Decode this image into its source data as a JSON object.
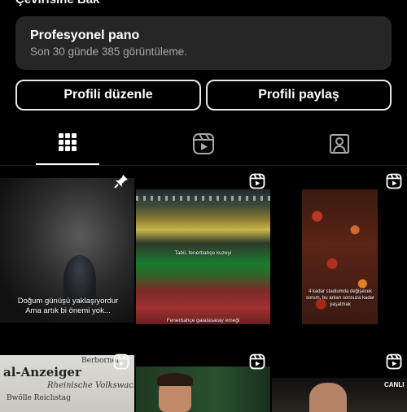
{
  "profile": {
    "top_partial_text": "Çevirisine Bak"
  },
  "dashboard": {
    "title": "Profesyonel pano",
    "subtitle": "Son 30 günde 385 görüntüleme."
  },
  "actions": {
    "edit_label": "Profili düzenle",
    "share_label": "Profili paylaş"
  },
  "tabs": [
    {
      "name": "grid",
      "icon": "grid-icon",
      "active": true
    },
    {
      "name": "reels",
      "icon": "reels-icon",
      "active": false
    },
    {
      "name": "tagged",
      "icon": "tagged-person-icon",
      "active": false
    }
  ],
  "posts": [
    {
      "badge": "pin-icon",
      "caption_line1": "Doğum günüşü yaklaşıyordur",
      "caption_line2": "Ama artık bi önemi yok..."
    },
    {
      "badge": "reels-icon",
      "caption_top": "Tabii, fenerbahçe kuzeyi",
      "caption_bottom": "Fenerbahçe galatasaray emeği"
    },
    {
      "badge": "reels-icon",
      "caption": "4 kadar stadiumda değişecek sorum, bu anları sonsuza kadar yaşatmak"
    },
    {
      "badge": "reels-icon",
      "newspaper_line0": "Berborner",
      "newspaper_title": "al-Anzeiger",
      "newspaper_sub": "Rheinische Volkswacht",
      "newspaper_line3": "Bwölle Reichstag"
    },
    {
      "badge": "reels-icon"
    },
    {
      "badge": "reels-icon",
      "caption": "CANLI"
    }
  ],
  "colors": {
    "background": "#000000",
    "card": "#262626",
    "text_secondary": "#a8a8a8"
  }
}
